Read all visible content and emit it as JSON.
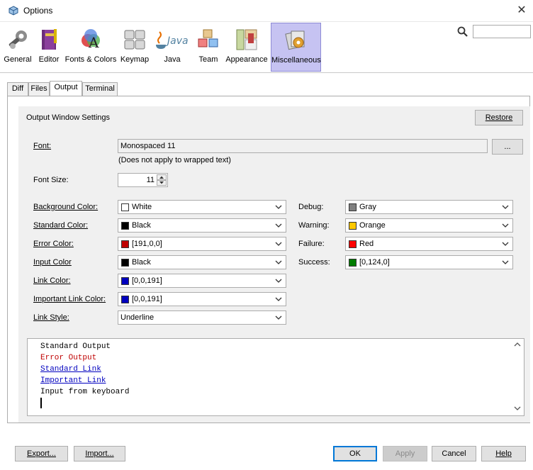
{
  "window": {
    "title": "Options",
    "close_glyph": "✕"
  },
  "toolbar": {
    "items": [
      {
        "label": "General",
        "icon": "wrench-gear-icon"
      },
      {
        "label": "Editor",
        "icon": "editor-book-icon"
      },
      {
        "label": "Fonts & Colors",
        "icon": "fonts-colors-icon"
      },
      {
        "label": "Keymap",
        "icon": "keymap-keyboard-icon"
      },
      {
        "label": "Java",
        "icon": "java-icon"
      },
      {
        "label": "Team",
        "icon": "team-cubes-icon"
      },
      {
        "label": "Appearance",
        "icon": "appearance-icon"
      },
      {
        "label": "Miscellaneous",
        "icon": "miscellaneous-icon"
      }
    ],
    "java_logo_text": "Java",
    "selected_index": 7
  },
  "search": {
    "value": ""
  },
  "tabs": [
    {
      "label": "Diff"
    },
    {
      "label": "Files"
    },
    {
      "label": "Output",
      "active": true
    },
    {
      "label": "Terminal"
    }
  ],
  "section": {
    "title": "Output Window Settings",
    "restore_label": "Restore"
  },
  "font": {
    "label": "Font:",
    "value": "Monospaced 11",
    "browse_label": "...",
    "note": "(Does not apply to wrapped text)"
  },
  "font_size": {
    "label": "Font Size:",
    "value": "11"
  },
  "colors_left": [
    {
      "label": "Background Color:",
      "value": "White",
      "swatch": "#ffffff"
    },
    {
      "label": "Standard Color:",
      "value": "Black",
      "swatch": "#000000"
    },
    {
      "label": "Error Color:",
      "value": "[191,0,0]",
      "swatch": "#bf0000"
    },
    {
      "label": "Input Color",
      "value": "Black",
      "swatch": "#000000"
    },
    {
      "label": "Link Color:",
      "value": "[0,0,191]",
      "swatch": "#0000bf"
    },
    {
      "label": "Important Link Color:",
      "value": "[0,0,191]",
      "swatch": "#0000bf"
    }
  ],
  "link_style": {
    "label": "Link Style:",
    "value": "Underline"
  },
  "colors_right": [
    {
      "label": "Debug:",
      "value": "Gray",
      "swatch": "#808080"
    },
    {
      "label": "Warning:",
      "value": "Orange",
      "swatch": "#ffc800"
    },
    {
      "label": "Failure:",
      "value": "Red",
      "swatch": "#ff0000"
    },
    {
      "label": "Success:",
      "value": "[0,124,0]",
      "swatch": "#007c00"
    }
  ],
  "preview": {
    "lines": [
      {
        "text": "Standard Output",
        "color": "#000000"
      },
      {
        "text": "Error Output",
        "color": "#bf0000"
      },
      {
        "text": "Standard Link",
        "color": "#0000bf"
      },
      {
        "text": "Important Link",
        "color": "#0000bf"
      },
      {
        "text": "Input from keyboard",
        "color": "#000000"
      }
    ]
  },
  "bottom": {
    "export_label": "Export...",
    "import_label": "Import...",
    "ok_label": "OK",
    "apply_label": "Apply",
    "cancel_label": "Cancel",
    "help_label": "Help"
  },
  "colors": {
    "selected_bg": "#c6c3f2",
    "selected_border": "#8f8bd6",
    "panel_bg": "#f0f0f0",
    "default_button": "#0078d7"
  }
}
